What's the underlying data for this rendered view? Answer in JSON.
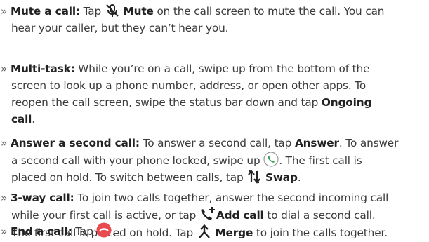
{
  "marker": "»",
  "items": [
    {
      "title": "Mute a call:",
      "t1": "Tap",
      "b1": "Mute",
      "t2": "on the call screen to mute the call. You can",
      "line2": "hear your caller, but they can’t hear you."
    },
    {
      "title": "Multi-task:",
      "t1": "While you’re on a call, swipe up from the bottom of the",
      "line2": "screen to look up a phone number, address, or open other apps. To",
      "line3": "reopen the call screen, swipe the status bar down and tap",
      "b1": "Ongoing",
      "b2": "call",
      "t2": "."
    },
    {
      "title": "Answer a second call:",
      "t1": "To answer a second call, tap",
      "b1": "Answer",
      "t2": ". To answer",
      "line2a": "a second call with your phone locked, swipe up",
      "line2b": ". The first call is",
      "line3a": "placed on hold. To switch between calls, tap",
      "b2": "Swap",
      "t3": "."
    },
    {
      "title": "3-way call:",
      "t1": "To join two calls together, answer the second incoming call",
      "line2a": "while your first call is active, or tap",
      "b1": "Add call",
      "line2b": "to dial a second call.",
      "line3a": "The first call is placed on hold. Tap",
      "b2": "Merge",
      "line3b": "to join the calls together."
    },
    {
      "title": "End a call:",
      "t1": "Tap",
      "t2": "."
    }
  ],
  "icons": {
    "mute": "mic-off-icon",
    "answer": "answer-call-icon",
    "swap": "swap-icon",
    "add_call": "add-call-icon",
    "merge": "merge-icon",
    "end": "end-call-icon"
  },
  "colors": {
    "text": "#3b3b3b",
    "bold": "#222222",
    "answer_green": "#3aa659",
    "end_red": "#e84a4f"
  }
}
